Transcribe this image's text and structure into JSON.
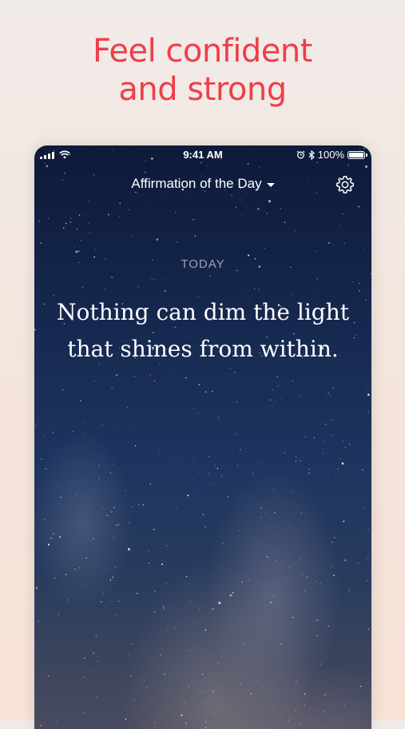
{
  "promo": {
    "headline_line1": "Feel confident",
    "headline_line2": "and strong",
    "color": "#ef3e4a"
  },
  "status_bar": {
    "time": "9:41 AM",
    "battery": "100%"
  },
  "nav": {
    "title": "Affirmation of the Day"
  },
  "content": {
    "date_label": "TODAY",
    "affirmation": "Nothing can dim the light that shines from within."
  }
}
